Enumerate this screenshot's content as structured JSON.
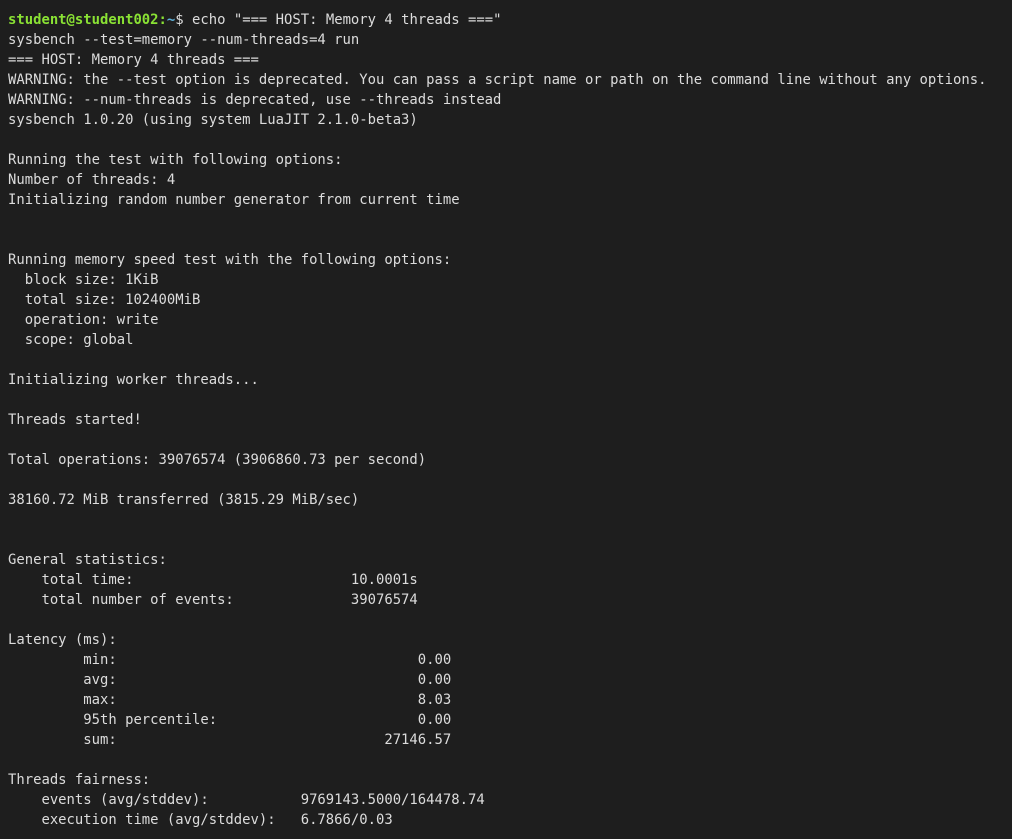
{
  "colors": {
    "background": "#1e1e1e",
    "foreground": "#dcdcdc",
    "prompt_user": "#8ae234",
    "prompt_path": "#5fafd7"
  },
  "prompt": {
    "user_host": "student@student002",
    "separator": ":",
    "path": "~",
    "symbol": "$ ",
    "command": "echo \"=== HOST: Memory 4 threads ===\""
  },
  "output_lines": [
    "sysbench --test=memory --num-threads=4 run",
    "=== HOST: Memory 4 threads ===",
    "WARNING: the --test option is deprecated. You can pass a script name or path on the command line without any options.",
    "WARNING: --num-threads is deprecated, use --threads instead",
    "sysbench 1.0.20 (using system LuaJIT 2.1.0-beta3)",
    "",
    "Running the test with following options:",
    "Number of threads: 4",
    "Initializing random number generator from current time",
    "",
    "",
    "Running memory speed test with the following options:",
    "  block size: 1KiB",
    "  total size: 102400MiB",
    "  operation: write",
    "  scope: global",
    "",
    "Initializing worker threads...",
    "",
    "Threads started!",
    "",
    "Total operations: 39076574 (3906860.73 per second)",
    "",
    "38160.72 MiB transferred (3815.29 MiB/sec)",
    "",
    "",
    "General statistics:",
    "    total time:                          10.0001s",
    "    total number of events:              39076574",
    "",
    "Latency (ms):",
    "         min:                                    0.00",
    "         avg:                                    0.00",
    "         max:                                    8.03",
    "         95th percentile:                        0.00",
    "         sum:                                27146.57",
    "",
    "Threads fairness:",
    "    events (avg/stddev):           9769143.5000/164478.74",
    "    execution time (avg/stddev):   6.7866/0.03"
  ]
}
